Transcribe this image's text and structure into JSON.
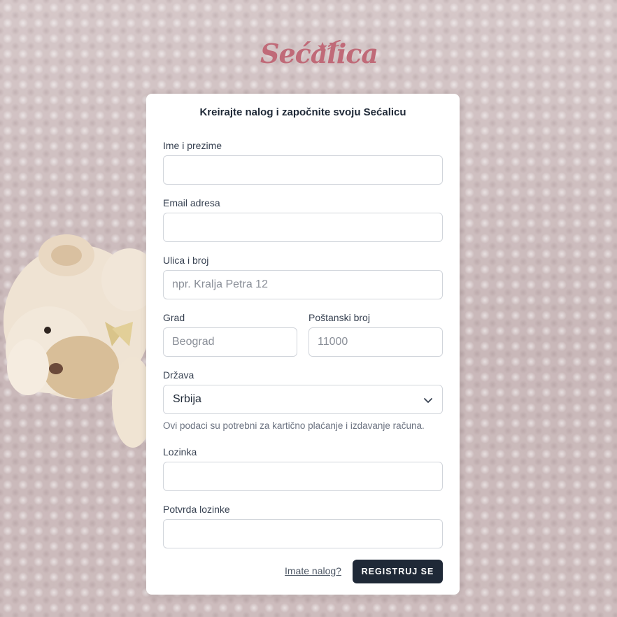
{
  "brand": {
    "logo_text": "Sećalica"
  },
  "form": {
    "title": "Kreirajte nalog i započnite svoju Sećalicu",
    "full_name": {
      "label": "Ime i prezime",
      "value": "",
      "placeholder": ""
    },
    "email": {
      "label": "Email adresa",
      "value": "",
      "placeholder": ""
    },
    "street": {
      "label": "Ulica i broj",
      "value": "",
      "placeholder": "npr. Kralja Petra 12"
    },
    "city": {
      "label": "Grad",
      "value": "",
      "placeholder": "Beograd"
    },
    "postal": {
      "label": "Poštanski broj",
      "value": "",
      "placeholder": "11000"
    },
    "country": {
      "label": "Država",
      "selected": "Srbija"
    },
    "help_text": "Ovi podaci su potrebni za kartično plaćanje i izdavanje računa.",
    "password": {
      "label": "Lozinka",
      "value": "",
      "placeholder": ""
    },
    "password_confirm": {
      "label": "Potvrda lozinke",
      "value": "",
      "placeholder": ""
    },
    "login_link": "Imate nalog?",
    "submit_label": "REGISTRUJ SE"
  },
  "colors": {
    "brand": "#c06a78",
    "button": "#1f2937",
    "card": "#ffffff"
  },
  "icons": {
    "country_select": "chevron-down-icon",
    "logo_decoration": "star-icon"
  }
}
